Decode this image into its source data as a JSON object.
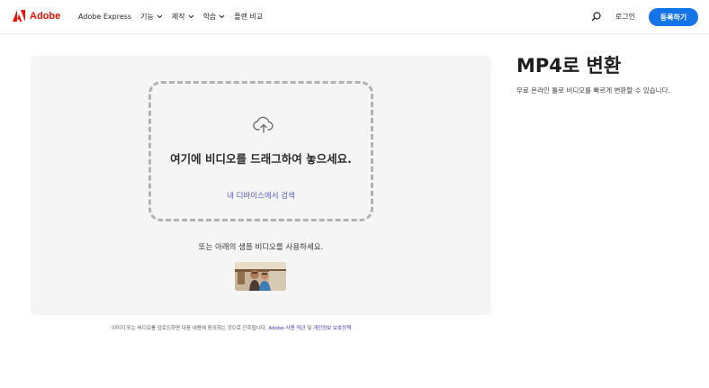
{
  "header": {
    "brand": "Adobe",
    "product": "Adobe Express",
    "nav": [
      {
        "label": "기능",
        "has_dropdown": true
      },
      {
        "label": "제작",
        "has_dropdown": true
      },
      {
        "label": "학습",
        "has_dropdown": true
      },
      {
        "label": "플랜 비교",
        "has_dropdown": false
      }
    ],
    "search_icon": "search-icon",
    "login_label": "로그인",
    "signup_label": "등록하기",
    "accent_color": "#1473e6",
    "brand_color": "#eb1000"
  },
  "upload": {
    "icon": "cloud-upload-icon",
    "drop_title": "여기에 비디오를 드래그하여 놓으세요.",
    "browse_label": "내 디바이스에서 검색",
    "sample_text": "또는 아래의 샘플 비디오를 사용하세요."
  },
  "terms": {
    "prefix": "이미지 또는 비디오를 업로드하면 다음 내용에 동의하는 것으로 간주됩니다. ",
    "terms_link": "Adobe 사용 약관",
    "middle": " 및 ",
    "privacy_link": "개인정보 보호정책"
  },
  "info": {
    "title": "MP4로 변환",
    "subtitle": "무료 온라인 툴로 비디오를 빠르게 변환할 수 있습니다."
  }
}
